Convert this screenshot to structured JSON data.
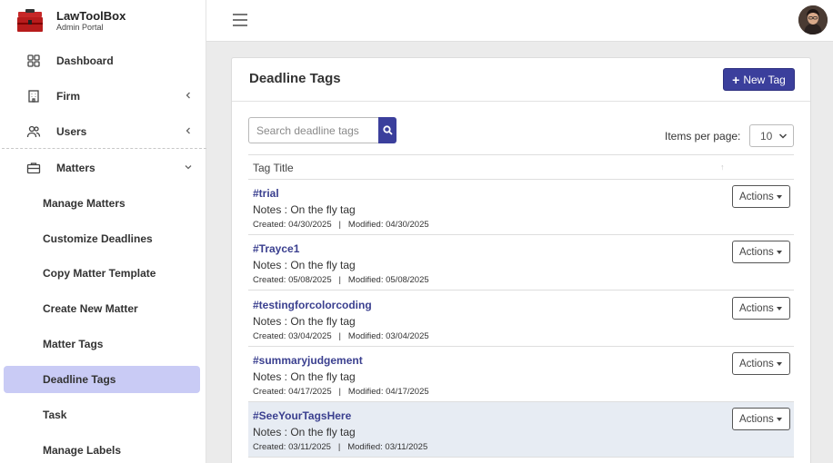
{
  "brand": {
    "name": "LawToolBox",
    "subtitle": "Admin Portal"
  },
  "sidebar": {
    "items": [
      {
        "label": "Dashboard",
        "icon": "grid-icon"
      },
      {
        "label": "Firm",
        "icon": "building-icon",
        "chevron": "chevron-left-icon"
      },
      {
        "label": "Users",
        "icon": "users-icon",
        "chevron": "chevron-left-icon"
      },
      {
        "label": "Matters",
        "icon": "briefcase-icon",
        "chevron": "chevron-down-icon"
      }
    ],
    "sub_items": [
      {
        "label": "Manage Matters"
      },
      {
        "label": "Customize Deadlines"
      },
      {
        "label": "Copy Matter Template"
      },
      {
        "label": "Create New Matter"
      },
      {
        "label": "Matter Tags"
      },
      {
        "label": "Deadline Tags",
        "active": true
      },
      {
        "label": "Task"
      },
      {
        "label": "Manage Labels"
      }
    ]
  },
  "main": {
    "title": "Deadline Tags",
    "new_button": "New Tag",
    "search": {
      "placeholder": "Search deadline tags",
      "value": ""
    },
    "items_per_page": {
      "label": "Items per page:",
      "value": "10"
    },
    "table": {
      "column": "Tag Title",
      "sort_indicator": "↑",
      "rows": [
        {
          "tag": "#trial",
          "notes": "Notes : On the fly tag",
          "meta": "Created: 04/30/2025   |   Modified: 04/30/2025",
          "action": "Actions"
        },
        {
          "tag": "#Trayce1",
          "notes": "Notes : On the fly tag",
          "meta": "Created: 05/08/2025   |   Modified: 05/08/2025",
          "action": "Actions"
        },
        {
          "tag": "#testingforcolorcoding",
          "notes": "Notes : On the fly tag",
          "meta": "Created: 03/04/2025   |   Modified: 03/04/2025",
          "action": "Actions"
        },
        {
          "tag": "#summaryjudgement",
          "notes": "Notes : On the fly tag",
          "meta": "Created: 04/17/2025   |   Modified: 04/17/2025",
          "action": "Actions"
        },
        {
          "tag": "#SeeYourTagsHere",
          "notes": "Notes : On the fly tag",
          "meta": "Created: 03/11/2025   |   Modified: 03/11/2025",
          "action": "Actions",
          "highlighted": true
        }
      ]
    }
  },
  "colors": {
    "accent": "#3b3f9c",
    "active_nav": "#c9cbf5",
    "link": "#3a3f8f"
  }
}
